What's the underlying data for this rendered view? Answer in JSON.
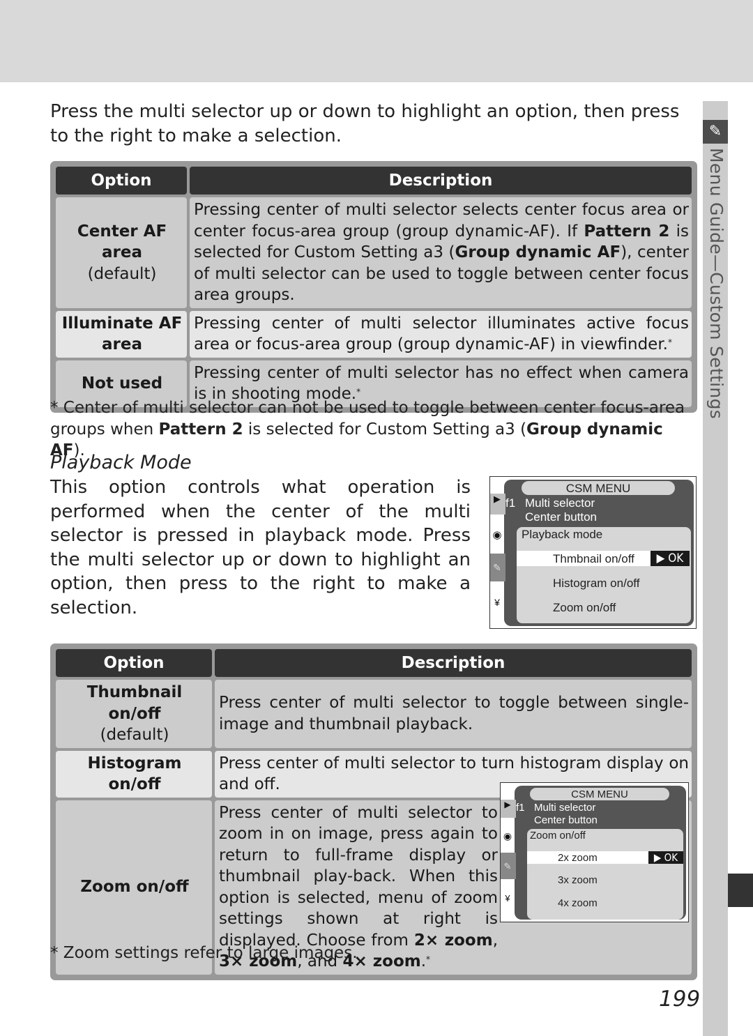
{
  "intro_text": "Press the multi selector up or down to highlight an option, then press to the right to make a selection.",
  "side_tab": {
    "icon": "pencil-icon",
    "label": "Menu Guide—Custom Settings"
  },
  "table1": {
    "headers": {
      "option": "Option",
      "description": "Description"
    },
    "rows": [
      {
        "option": "Center AF area",
        "note": "(default)",
        "desc_parts": [
          "Pressing center of multi selector selects center focus area or center focus-area group (group dynamic-AF).  If ",
          "Pattern 2",
          " is selected for Custom Setting a3 (",
          "Group dynamic AF",
          "), center of multi selector can be used to toggle between center focus area groups."
        ]
      },
      {
        "option": "Illuminate AF area",
        "desc": "Pressing center of multi selector illuminates active focus area or focus-area group (group dynamic-AF) in viewfinder.",
        "mark": "*"
      },
      {
        "option": "Not used",
        "desc": "Pressing center of multi selector has no effect when camera is in shooting mode.",
        "mark": "*"
      }
    ]
  },
  "footnote1": {
    "parts": [
      "* Center of multi selector can not be used to toggle between center focus-area groups when ",
      "Pattern 2",
      " is selected for Custom Setting a3 (",
      "Group dynamic AF",
      ")."
    ]
  },
  "playback": {
    "title": "Playback Mode",
    "text": "This option controls what operation is performed when the center of the multi selector is pressed in playback mode.  Press the multi selector up or down to highlight an option, then press to the right to make a selection."
  },
  "camera_menu1": {
    "title": "CSM MENU",
    "code": "f1",
    "line1": "Multi selector",
    "line2": "Center button",
    "panel_title": "Playback mode",
    "items": [
      "Thmbnail on/off",
      "Histogram on/off",
      "Zoom on/off"
    ],
    "selected_index": 0,
    "ok_label": "▶ OK"
  },
  "table2": {
    "headers": {
      "option": "Option",
      "description": "Description"
    },
    "rows": [
      {
        "option": "Thumbnail on/off",
        "note": "(default)",
        "desc": "Press center of multi selector to toggle between single-image and thumbnail playback."
      },
      {
        "option": "Histogram on/off",
        "desc": "Press center of multi selector to turn histogram display on and off."
      },
      {
        "option": "Zoom on/off",
        "desc_parts": [
          "Press center of multi selector to zoom in on image, press again to return to full-frame display or thumbnail play-back.  When this option is selected, menu of zoom settings shown at right is displayed.  Choose from ",
          "2× zoom",
          ", ",
          "3× zoom",
          ", and ",
          "4× zoom",
          "."
        ],
        "mark": "*"
      }
    ]
  },
  "camera_menu2": {
    "title": "CSM MENU",
    "code": "f1",
    "line1": "Multi selector",
    "line2": "Center button",
    "panel_title": "Zoom on/off",
    "items": [
      "2x zoom",
      "3x zoom",
      "4x zoom"
    ],
    "selected_index": 0,
    "ok_label": "▶ OK"
  },
  "footnote2": "* Zoom settings refer to large images.",
  "page_number": "199"
}
